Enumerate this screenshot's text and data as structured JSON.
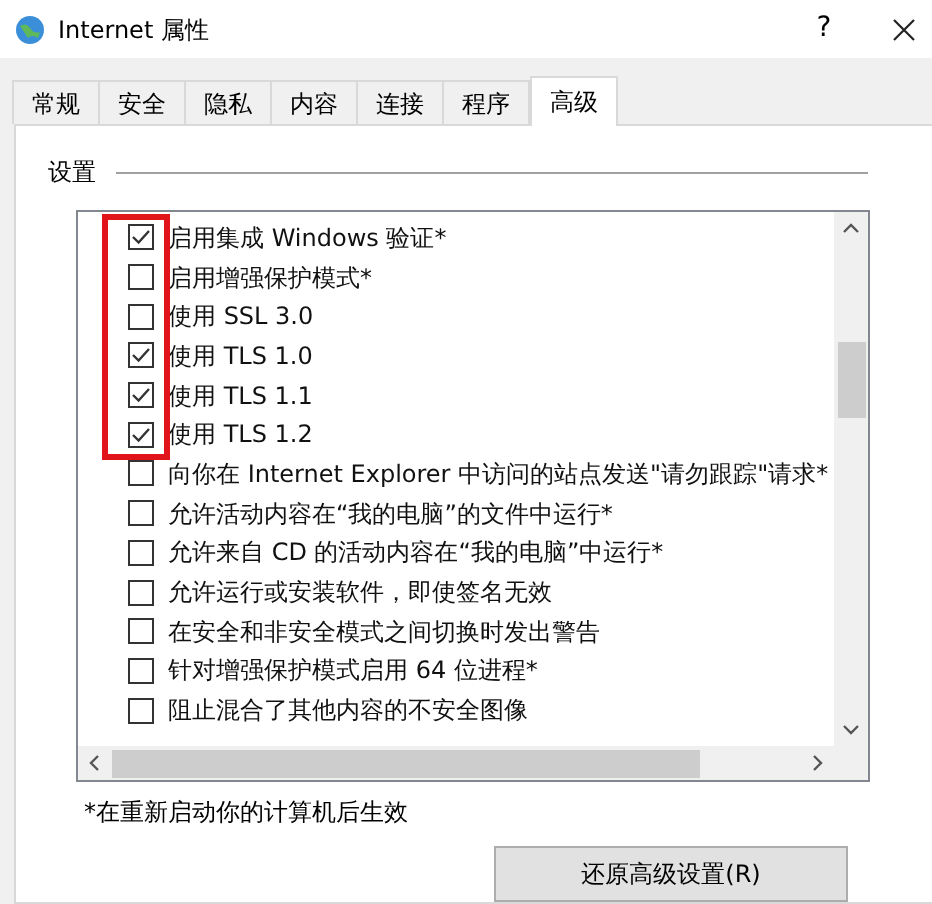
{
  "window": {
    "title": "Internet 属性",
    "help": "?"
  },
  "tabs": [
    {
      "label": "常规",
      "selected": false
    },
    {
      "label": "安全",
      "selected": false
    },
    {
      "label": "隐私",
      "selected": false
    },
    {
      "label": "内容",
      "selected": false
    },
    {
      "label": "连接",
      "selected": false
    },
    {
      "label": "程序",
      "selected": false
    },
    {
      "label": "高级",
      "selected": true
    }
  ],
  "settings": {
    "heading": "设置",
    "annotated_group": {
      "kind": "frame",
      "items": [
        {
          "label": "启用集成 Windows 验证*",
          "checked": true
        },
        {
          "label": "启用增强保护模式*",
          "checked": false
        },
        {
          "label": "使用 SSL 3.0",
          "checked": false
        },
        {
          "label": "使用 TLS 1.0",
          "checked": true
        },
        {
          "label": "使用 TLS 1.1",
          "checked": true
        },
        {
          "label": "使用 TLS 1.2",
          "checked": true
        }
      ]
    },
    "items": [
      {
        "label": "向你在 Internet Explorer 中访问的站点发送\"请勿跟踪\"请求*",
        "checked": false
      },
      {
        "label": "允许活动内容在“我的电脑”的文件中运行*",
        "checked": false
      },
      {
        "label": "允许来自 CD 的活动内容在“我的电脑”中运行*",
        "checked": false
      },
      {
        "label": "允许运行或安装软件，即使签名无效",
        "checked": false
      },
      {
        "label": "在安全和非安全模式之间切换时发出警告",
        "checked": false
      },
      {
        "label": "针对增强保护模式启用 64 位进程*",
        "checked": false
      },
      {
        "label": "阻止混合了其他内容的不安全图像",
        "checked": false
      }
    ],
    "footnote": "*在重新启动你的计算机后生效"
  },
  "buttons": [
    {
      "label": "还原高级设置(R)"
    }
  ]
}
